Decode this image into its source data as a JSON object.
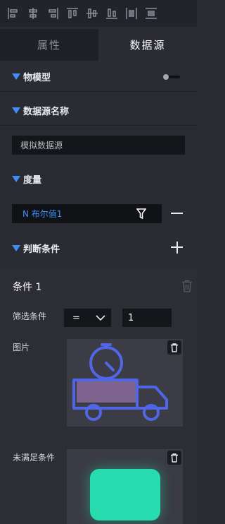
{
  "toolbar": {
    "icons": [
      "align-left-icon",
      "align-center-horizontal-icon",
      "align-right-icon",
      "align-top-icon",
      "align-middle-vertical-icon",
      "align-bottom-icon",
      "distribute-horizontal-icon",
      "distribute-vertical-icon"
    ]
  },
  "tabs": [
    {
      "label": "属性",
      "active": false
    },
    {
      "label": "数据源",
      "active": true
    }
  ],
  "sections": {
    "model": {
      "title": "物模型",
      "toggle_on": false
    },
    "source_name": {
      "title": "数据源名称",
      "value": "模拟数据源"
    },
    "measure": {
      "title": "度量",
      "field": "N 布尔值1"
    },
    "condition": {
      "title": "判断条件"
    }
  },
  "condition": {
    "title": "条件 1",
    "filter_label": "筛选条件",
    "operator": "=",
    "value": "1",
    "image_label": "图片",
    "unmet_label": "未满足条件"
  },
  "colors": {
    "accent": "#3e8ef7",
    "green": "#27dcae",
    "truck": "#5066e6"
  }
}
